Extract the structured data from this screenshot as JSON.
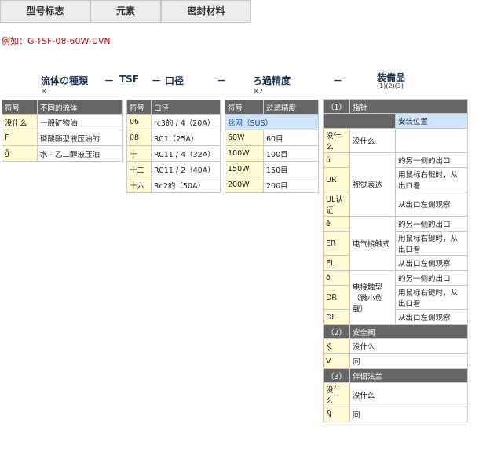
{
  "tabs": [
    {
      "label": "型号标志"
    },
    {
      "label": "元素"
    },
    {
      "label": "密封材料"
    }
  ],
  "example": "例如：G-TSF-08-60W-UVN",
  "headers": {
    "fluid": "流体の種類",
    "dash1": "－",
    "tsf": "TSF",
    "dash2": "－",
    "port": "口径",
    "dash3": "－",
    "filter": "ろ過精度",
    "dash4": "－",
    "equip": "装備品",
    "note1": "※1",
    "note2": "※2",
    "note3": "(1)(2)(3)"
  },
  "fluid_table": {
    "col_code": "符号",
    "col_name": "不同的流体",
    "rows": [
      {
        "code": "没什么",
        "name": "一般矿物油"
      },
      {
        "code": "F",
        "name": "磷酸酯型液压油的"
      },
      {
        "code": "ĝ",
        "name": "水 - 乙二醇液压油"
      }
    ]
  },
  "port_table": {
    "col_code": "符号",
    "col_name": "口径",
    "rows": [
      {
        "code": "06",
        "name": "rc3的 / 4（20A）"
      },
      {
        "code": "08",
        "name": "RC1（25A）"
      },
      {
        "code": "十",
        "name": "RC11 / 4（32A）"
      },
      {
        "code": "十二",
        "name": "RC11 / 2（40A）"
      },
      {
        "code": "十六",
        "name": "Rc2的（50A）"
      }
    ]
  },
  "filter_table": {
    "col_code": "符号",
    "col_name": "过滤精度",
    "material": "丝网（SUS）",
    "rows": [
      {
        "code": "60W",
        "name": "60目"
      },
      {
        "code": "100W",
        "name": "100目"
      },
      {
        "code": "150W",
        "name": "150目"
      },
      {
        "code": "200W",
        "name": "200目"
      }
    ]
  },
  "equip_table": {
    "s1_num": "（1）",
    "s1_title": "指针",
    "s1_sub": "安装位置",
    "none_code": "没什么",
    "none_text": "没什么",
    "visual_label": "视觉表达",
    "elec_label": "电气接触式",
    "contact_label": "电接触型（微小负载）",
    "opt_other": "的另一侧的出口",
    "opt_right": "用鼠标右键时，从出口看",
    "opt_left": "从出口左侧观察",
    "rows_visual": [
      {
        "code": "ü"
      },
      {
        "code": "UR"
      },
      {
        "code": "UL认证"
      }
    ],
    "rows_elec": [
      {
        "code": "ê"
      },
      {
        "code": "ER"
      },
      {
        "code": "EL"
      }
    ],
    "rows_contact": [
      {
        "code": "ð"
      },
      {
        "code": "DR"
      },
      {
        "code": "DL"
      }
    ],
    "s2_num": "（2）",
    "s2_title": "安全阀",
    "s2_rows": [
      {
        "code": "Ķ",
        "name": "没什么"
      },
      {
        "code": "V",
        "name": "同"
      }
    ],
    "s3_num": "（3）",
    "s3_title": "伴侣法兰",
    "s3_rows": [
      {
        "code": "没什么",
        "name": "没什么"
      },
      {
        "code": "Ñ",
        "name": "同"
      }
    ]
  }
}
